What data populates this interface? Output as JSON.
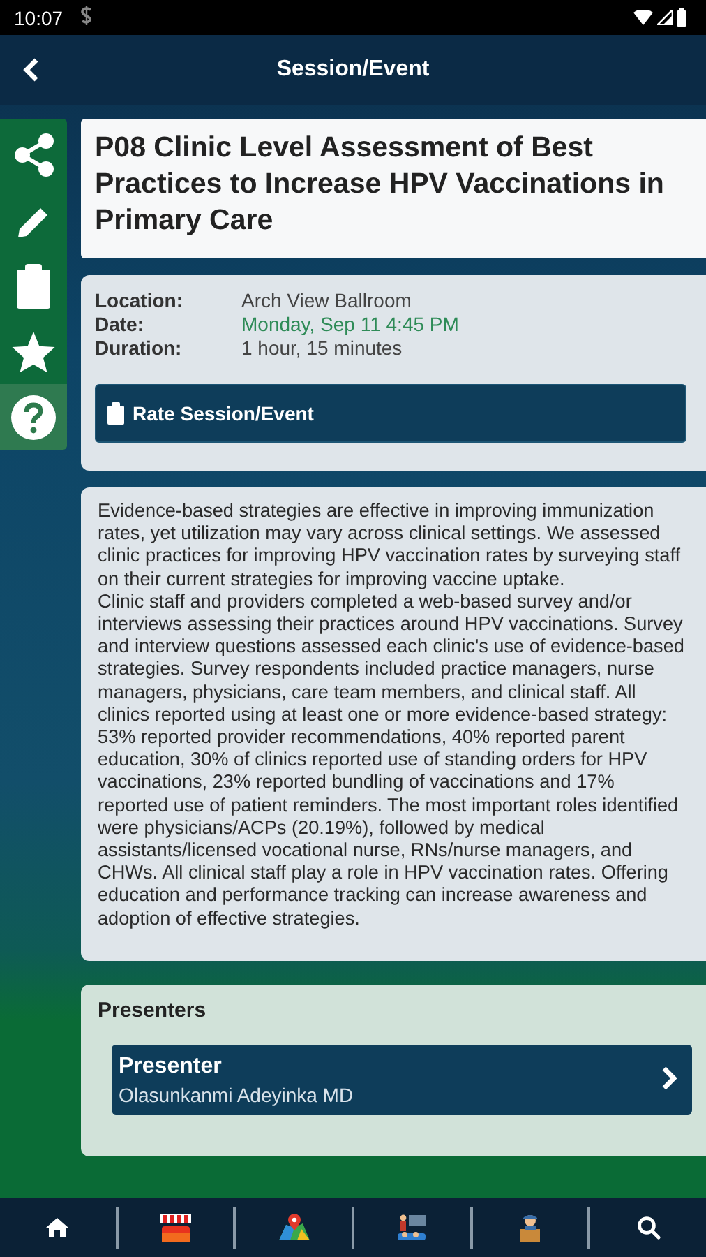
{
  "status_bar": {
    "time": "10:07"
  },
  "header": {
    "title": "Session/Event"
  },
  "side_actions": [
    {
      "kind": "share",
      "selected": false
    },
    {
      "kind": "edit",
      "selected": false
    },
    {
      "kind": "notes",
      "selected": false
    },
    {
      "kind": "favorite",
      "selected": false
    },
    {
      "kind": "help",
      "selected": true
    }
  ],
  "session": {
    "title": "P08 Clinic Level Assessment of Best Practices to Increase HPV Vaccinations in Primary Care",
    "details": [
      {
        "label": "Location:",
        "value": "Arch View Ballroom",
        "kind": "plain"
      },
      {
        "label": "Date:",
        "value": "Monday, Sep 11 4:45 PM",
        "kind": "date"
      },
      {
        "label": "Duration:",
        "value": "1 hour, 15 minutes",
        "kind": "plain"
      }
    ],
    "rate_button": "Rate Session/Event"
  },
  "abstract": [
    "Evidence-based strategies are effective in improving immunization rates, yet utilization may vary across clinical settings. We assessed clinic practices for improving HPV vaccination rates by surveying staff on their current strategies for improving vaccine uptake.",
    "Clinic staff and providers completed a web-based survey and/or interviews assessing their practices around HPV vaccinations. Survey and interview questions assessed each clinic's use of evidence-based strategies. Survey respondents included practice managers, nurse managers, physicians, care team members, and clinical staff. All clinics reported using at least one or more evidence-based strategy: 53% reported provider recommendations, 40% reported parent education, 30% of clinics reported use of standing orders for HPV vaccinations, 23% reported bundling of vaccinations and 17% reported use of patient reminders. The most important roles identified were physicians/ACPs (20.19%), followed by medical assistants/licensed vocational nurse, RNs/nurse managers, and CHWs. All clinical staff play a role in HPV vaccination rates. Offering education and performance tracking can increase awareness and adoption of effective strategies."
  ],
  "presenters": {
    "heading": "Presenters",
    "items": [
      {
        "role": "Presenter",
        "name": "Olasunkanmi Adeyinka MD"
      }
    ]
  },
  "bottom_nav": [
    {
      "kind": "home"
    },
    {
      "kind": "store"
    },
    {
      "kind": "map"
    },
    {
      "kind": "presenter"
    },
    {
      "kind": "person"
    },
    {
      "kind": "search"
    }
  ]
}
